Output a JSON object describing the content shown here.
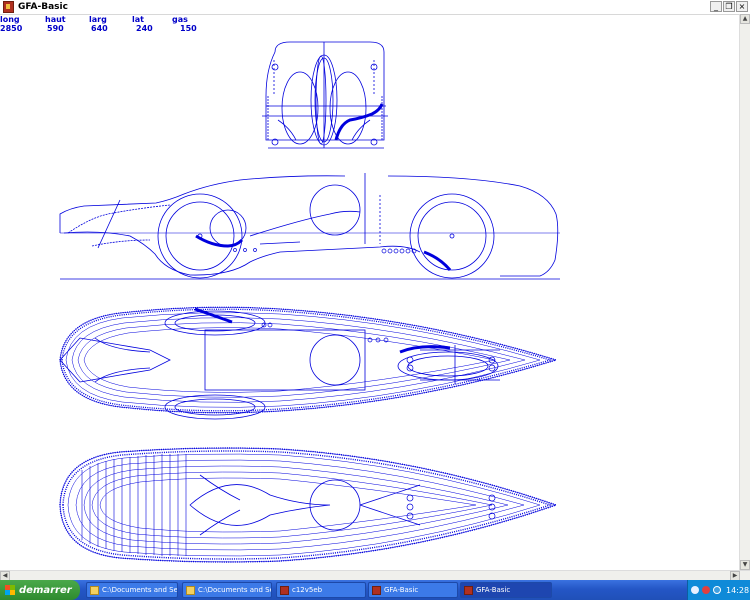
{
  "window": {
    "title": "GFA-Basic",
    "minimize": "_",
    "restore": "❐",
    "close": "×"
  },
  "params": [
    {
      "label": "long",
      "value": "2850"
    },
    {
      "label": "haut",
      "value": "590"
    },
    {
      "label": "larg",
      "value": "640"
    },
    {
      "label": "lat",
      "value": "240"
    },
    {
      "label": "gas",
      "value": "150"
    }
  ],
  "colors": {
    "line": "#0000dd",
    "text": "#0000c8",
    "taskbar": "#2456c6",
    "start": "#3a9a3a"
  },
  "taskbar": {
    "start_label": "demarrer",
    "tasks": [
      {
        "label": "C:\\Documents and Se...",
        "icon": "folder-icon"
      },
      {
        "label": "C:\\Documents and Se...",
        "icon": "folder-icon"
      },
      {
        "label": "c12v5eb",
        "icon": "gfa-icon"
      },
      {
        "label": "GFA-Basic",
        "icon": "gfa-icon"
      },
      {
        "label": "GFA-Basic",
        "icon": "gfa-icon",
        "active": true
      }
    ],
    "clock": "14:28"
  }
}
